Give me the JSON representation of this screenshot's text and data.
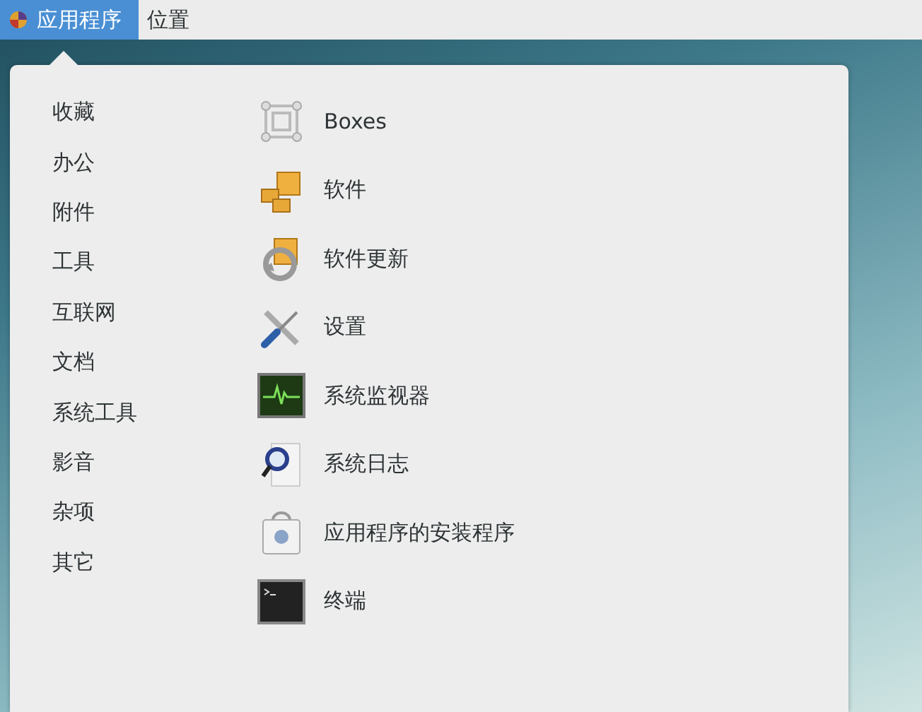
{
  "top_bar": {
    "menus": [
      {
        "label": "应用程序",
        "selected": true
      },
      {
        "label": "位置",
        "selected": false
      }
    ]
  },
  "categories": [
    {
      "label": "收藏"
    },
    {
      "label": "办公"
    },
    {
      "label": "附件"
    },
    {
      "label": "工具"
    },
    {
      "label": "互联网"
    },
    {
      "label": "文档"
    },
    {
      "label": "系统工具"
    },
    {
      "label": "影音"
    },
    {
      "label": "杂项"
    },
    {
      "label": "其它"
    }
  ],
  "apps": [
    {
      "label": "Boxes",
      "kind": "boxes"
    },
    {
      "label": "软件",
      "kind": "software"
    },
    {
      "label": "软件更新",
      "kind": "update"
    },
    {
      "label": "设置",
      "kind": "settings"
    },
    {
      "label": "系统监视器",
      "kind": "monitor"
    },
    {
      "label": "系统日志",
      "kind": "log"
    },
    {
      "label": "应用程序的安装程序",
      "kind": "installer"
    },
    {
      "label": "终端",
      "kind": "terminal"
    }
  ]
}
